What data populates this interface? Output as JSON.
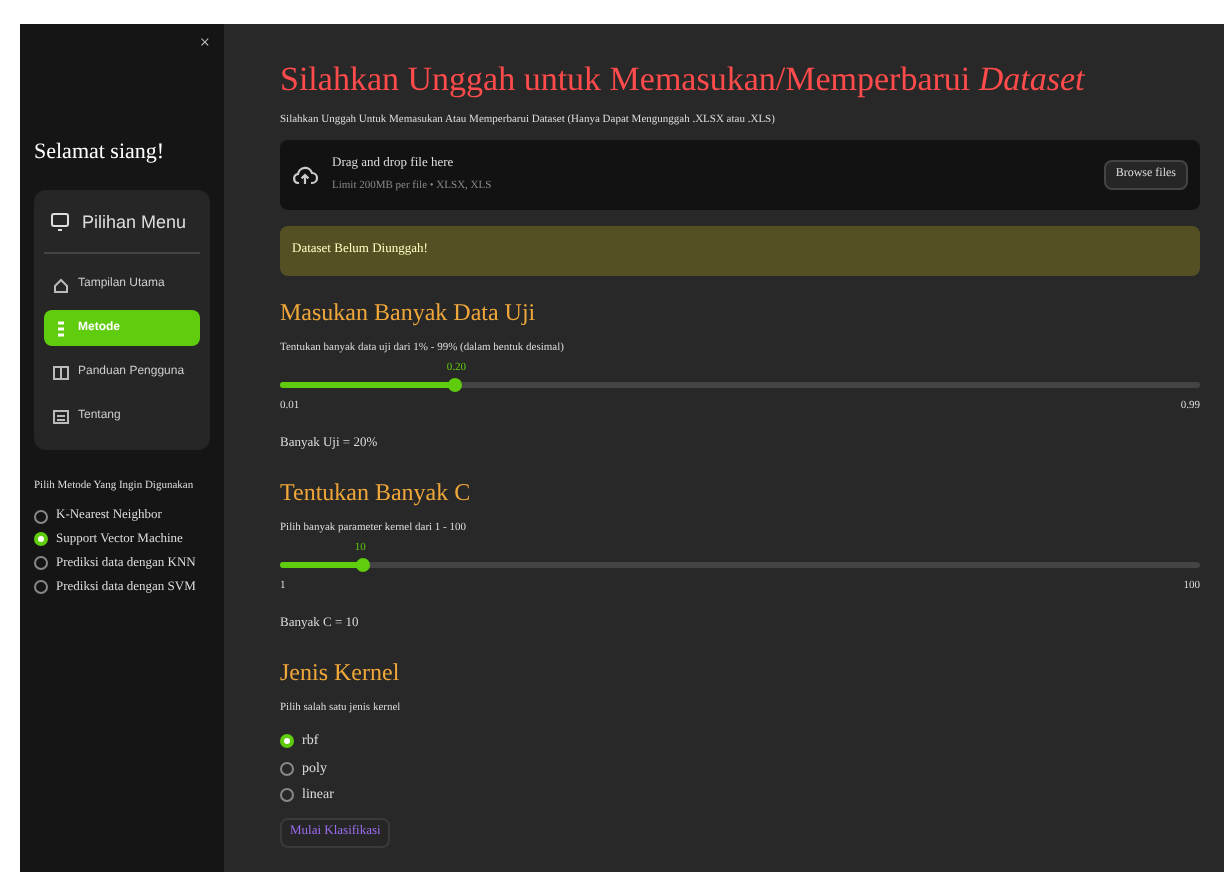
{
  "sidebar": {
    "close": "×",
    "greeting": "Selamat siang!",
    "menu": {
      "title": "Pilihan Menu",
      "items": [
        {
          "label": "Tampilan Utama",
          "selected": false
        },
        {
          "label": "Metode",
          "selected": true
        },
        {
          "label": "Panduan Pengguna",
          "selected": false
        },
        {
          "label": "Tentang",
          "selected": false
        }
      ]
    },
    "method_label": "Pilih Metode Yang Ingin Digunakan",
    "methods": [
      {
        "label": "K-Nearest Neighbor",
        "selected": false
      },
      {
        "label": "Support Vector Machine",
        "selected": true
      },
      {
        "label": "Prediksi data dengan KNN",
        "selected": false
      },
      {
        "label": "Prediksi data dengan SVM",
        "selected": false
      }
    ]
  },
  "main": {
    "title": "Silahkan Unggah untuk Memasukan/Memperbarui *Dataset*",
    "subtitle": "Silahkan Unggah Untuk Memasukan Atau Memperbarui Dataset (Hanya Dapat Mengunggah .XLSX atau .XLS)",
    "uploader": {
      "title": "Drag and drop file here",
      "hint": "Limit 200MB per file • XLSX, XLS",
      "button": "Browse files"
    },
    "warning": "Dataset Belum Diunggah!",
    "sections": [
      {
        "kind": "slider",
        "heading": "Masukan Banyak Data Uji",
        "description": "Tentukan banyak data uji dari 1% - 99% (dalam bentuk desimal)",
        "value": "0.20",
        "level": 0.19,
        "min": "0.01",
        "max": "0.99",
        "result": "Banyak Uji = 20%"
      },
      {
        "kind": "slider",
        "heading": "Tentukan Banyak C",
        "description": "Pilih banyak parameter kernel dari 1 - 100",
        "value": "10",
        "level": 0.09,
        "min": "1",
        "max": "100",
        "result": "Banyak C = 10"
      },
      {
        "kind": "radio",
        "heading": "Jenis Kernel",
        "description": "Pilih salah satu jenis kernel",
        "options": [
          {
            "label": "rbf",
            "selected": true
          },
          {
            "label": "poly",
            "selected": false
          },
          {
            "label": "linear",
            "selected": false
          }
        ]
      }
    ],
    "button": "Mulai Klasifikasi"
  }
}
